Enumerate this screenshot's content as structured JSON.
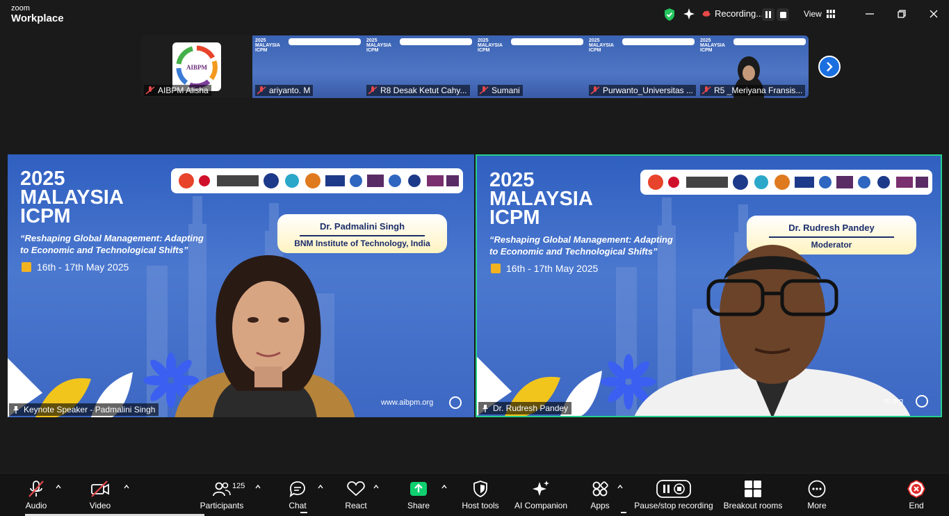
{
  "app": {
    "brand_small": "zoom",
    "brand_large": "Workplace"
  },
  "titlebar": {
    "recording_label": "Recording...",
    "view_label": "View"
  },
  "strip": {
    "tiles": [
      {
        "name": "AIBPM Alisha",
        "logo_text": "AIBPM"
      },
      {
        "name": "ariyanto. M"
      },
      {
        "name": "R8 Desak Ketut Cahy..."
      },
      {
        "name": "Sumani"
      },
      {
        "name": "Purwanto_Universitas ..."
      },
      {
        "name": "R5 _Meriyana Fransis..."
      }
    ],
    "thumb_title": "2025 MALAYSIA ICPM"
  },
  "videos": [
    {
      "title_line1": "2025",
      "title_line2": "MALAYSIA",
      "title_line3": "ICPM",
      "subtitle_line1": "“Reshaping Global Management: Adapting",
      "subtitle_line2": "to Economic and Technological Shifts”",
      "date": "16th - 17th May 2025",
      "card_name": "Dr. Padmalini Singh",
      "card_role": "BNM Institute of Technology, India",
      "url": "www.aibpm.org",
      "participant": "Keynote Speaker - Padmalini Singh"
    },
    {
      "title_line1": "2025",
      "title_line2": "MALAYSIA",
      "title_line3": "ICPM",
      "subtitle_line1": "“Reshaping Global Management: Adapting",
      "subtitle_line2": "to Economic and Technological Shifts”",
      "date": "16th - 17th May 2025",
      "card_name": "Dr. Rudresh Pandey",
      "card_role": "Moderator",
      "url": "m.org",
      "participant": "Dr. Rudresh Pandey"
    }
  ],
  "toolbar": {
    "audio": "Audio",
    "video": "Video",
    "participants": "Participants",
    "participants_count": "125",
    "chat": "Chat",
    "react": "React",
    "share": "Share",
    "host_tools": "Host tools",
    "ai_companion": "AI Companion",
    "apps": "Apps",
    "pause_stop": "Pause/stop recording",
    "breakout": "Breakout rooms",
    "more": "More",
    "end": "End"
  },
  "colors": {
    "accent_green": "#23d18b",
    "share_green": "#0fcf6f",
    "end_red": "#e02828",
    "blue": "#1a6fe0"
  }
}
